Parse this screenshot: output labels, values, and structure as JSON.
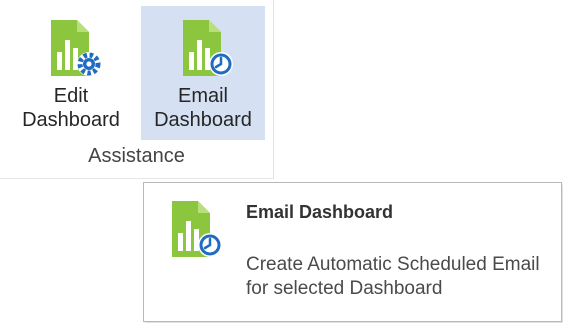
{
  "ribbon": {
    "buttons": [
      {
        "line1": "Edit",
        "line2": "Dashboard",
        "icon": "dashboard-settings-icon"
      },
      {
        "line1": "Email",
        "line2": "Dashboard",
        "icon": "dashboard-schedule-icon"
      }
    ],
    "group_label": "Assistance"
  },
  "tooltip": {
    "title": "Email Dashboard",
    "description": "Create Automatic Scheduled Email for selected Dashboard",
    "icon": "dashboard-schedule-icon"
  },
  "colors": {
    "icon_green": "#8cc63f",
    "icon_green_dark": "#4c8c1e",
    "accent_blue": "#1f6cc0",
    "selected_bg": "#d5e1f2"
  }
}
